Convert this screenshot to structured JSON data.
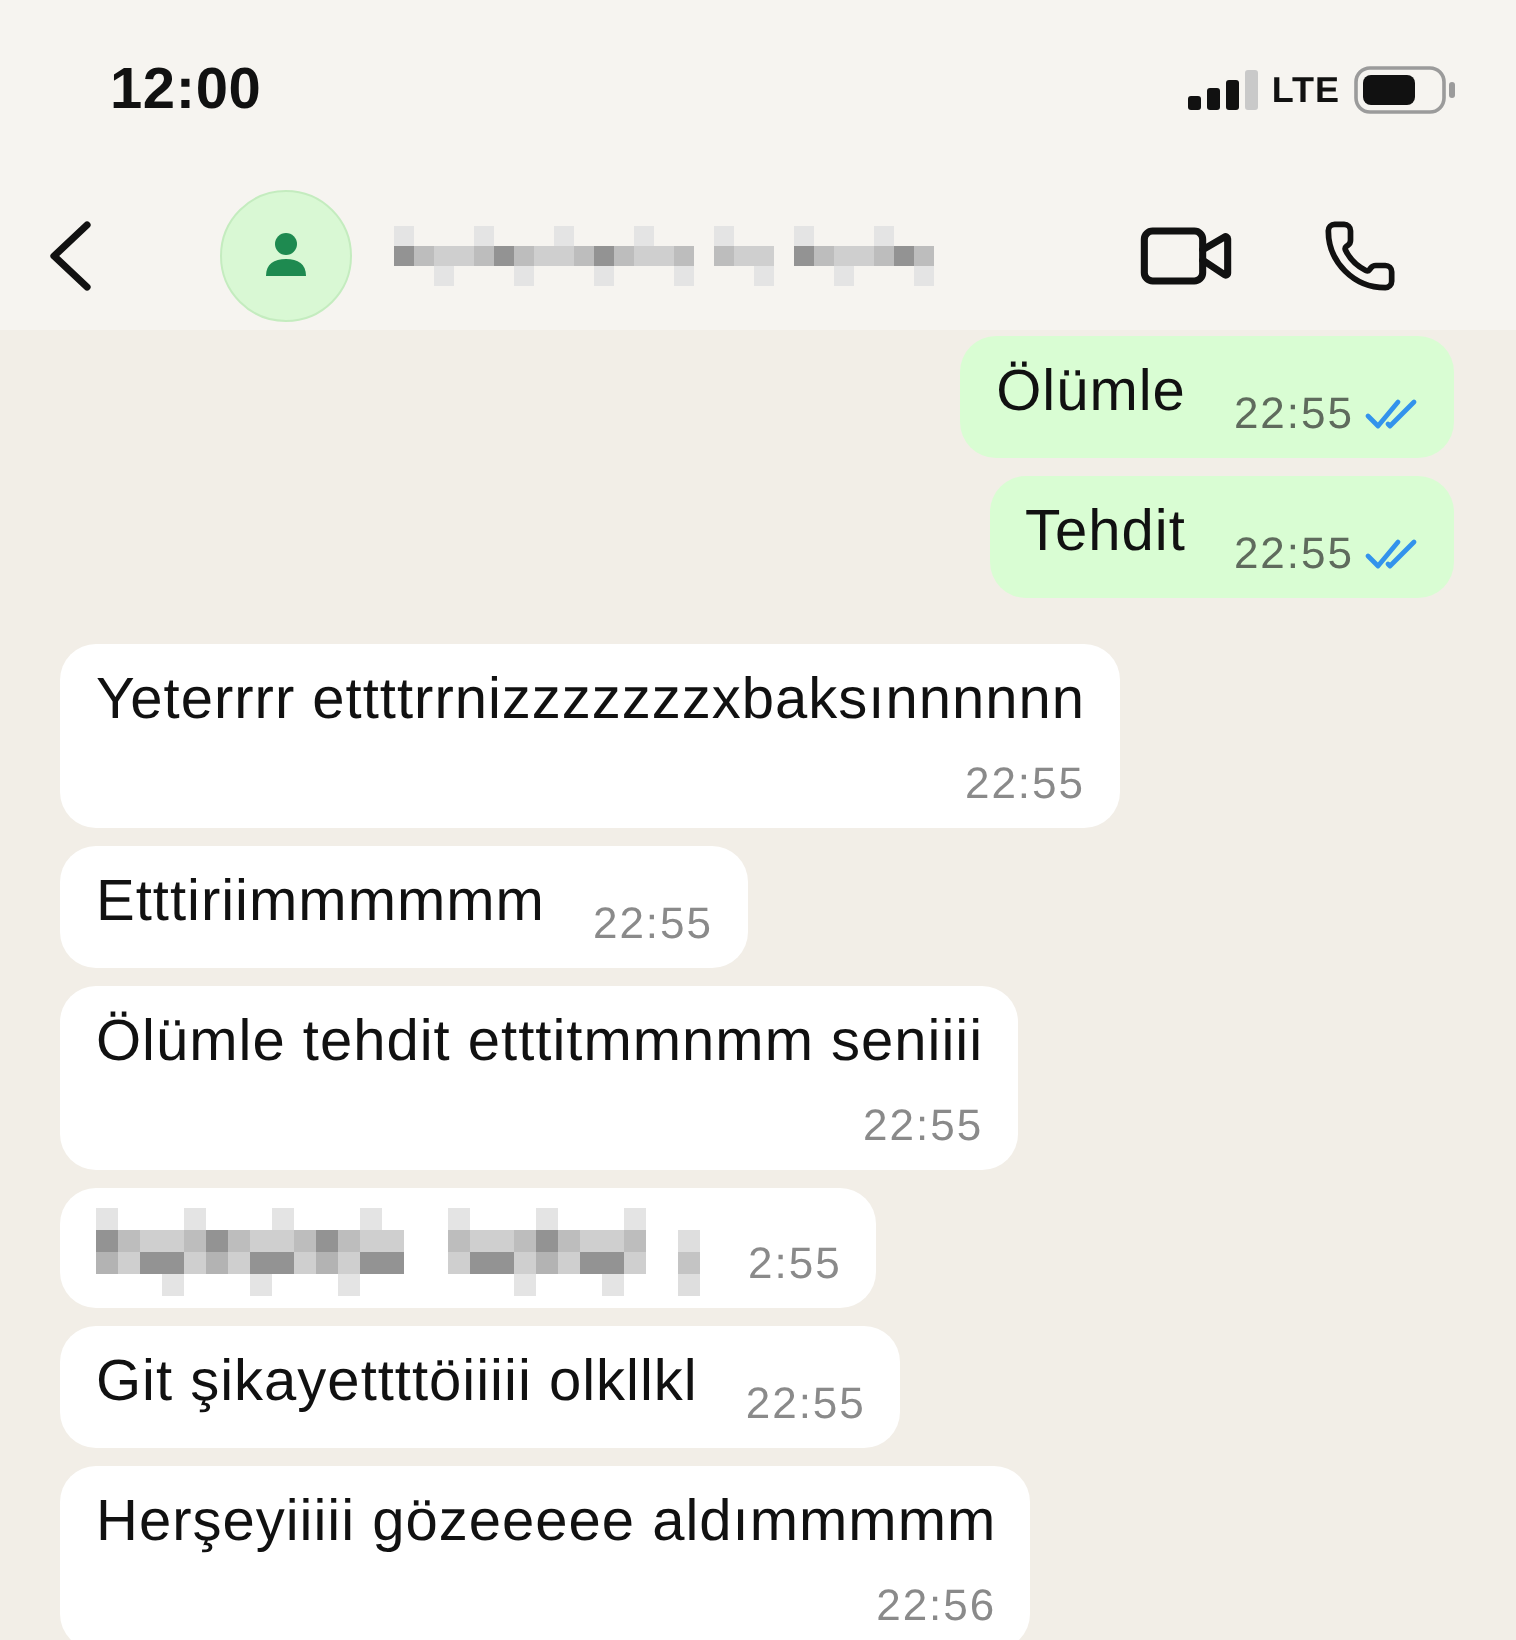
{
  "status_bar": {
    "time": "12:00",
    "network": "LTE"
  },
  "header": {
    "name_blurred": true
  },
  "messages": [
    {
      "kind": "outgoing",
      "text": "Ölümle",
      "time": "22:55",
      "read": true,
      "blurred": false
    },
    {
      "kind": "outgoing",
      "text": "Tehdit",
      "time": "22:55",
      "read": true,
      "blurred": false
    },
    {
      "kind": "incoming",
      "text": "Yeterrrr ettttrrnizzzzzzzxbaksınnnnnn",
      "time": "22:55",
      "blurred": false
    },
    {
      "kind": "incoming",
      "text": "Etttiriimmmmmm",
      "time": "22:55",
      "blurred": false
    },
    {
      "kind": "incoming",
      "text": "Ölümle tehdit etttitmmnmm seniiii",
      "time": "22:55",
      "blurred": false
    },
    {
      "kind": "incoming",
      "blurred": true,
      "time": "2:55"
    },
    {
      "kind": "incoming",
      "text": "Git şikayettttöiiiii olkllkl",
      "time": "22:55",
      "blurred": false
    },
    {
      "kind": "incoming",
      "text": "Herşeyiiiii gözeeeee aldımmmmm",
      "time": "22:56",
      "blurred": false
    }
  ]
}
